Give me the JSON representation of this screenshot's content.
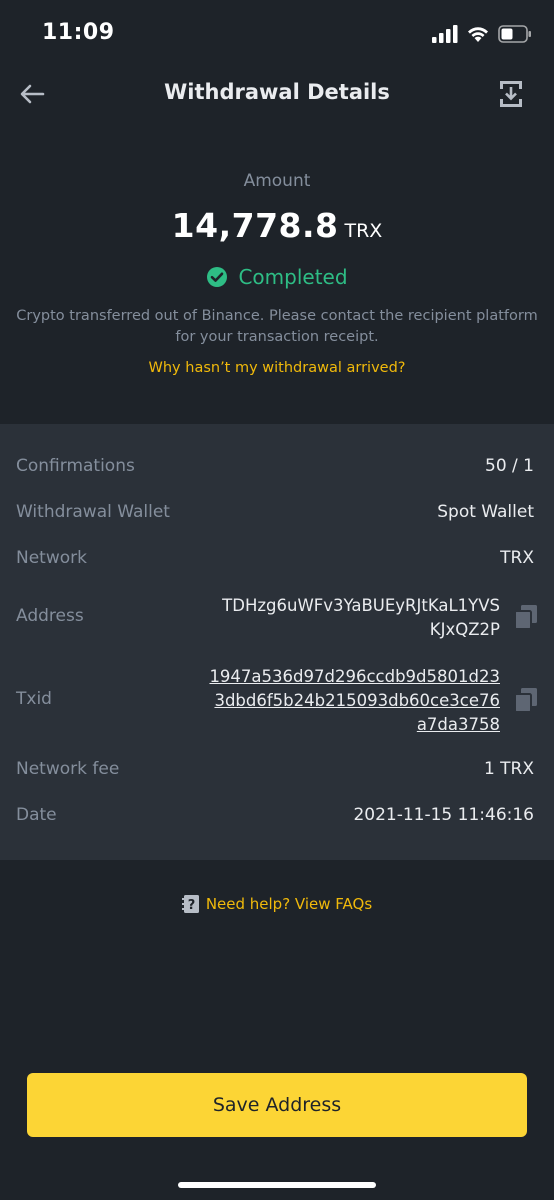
{
  "status_bar": {
    "time": "11:09",
    "icons": [
      "signal-icon",
      "wifi-icon",
      "battery-icon"
    ]
  },
  "nav": {
    "title": "Withdrawal Details",
    "back_icon": "back-arrow-icon",
    "share_icon": "share-export-icon"
  },
  "summary": {
    "amount_label": "Amount",
    "amount_value": "14,778.8",
    "amount_unit": "TRX",
    "status": "Completed",
    "status_color": "#2ebd85",
    "info_line1": "Crypto transferred out of Binance. Please contact the recipient platform",
    "info_line2": "for your transaction receipt.",
    "help_link": "Why hasn’t my withdrawal arrived?"
  },
  "details": {
    "confirmations": {
      "label": "Confirmations",
      "value": "50 / 1"
    },
    "wallet": {
      "label": "Withdrawal Wallet",
      "value": "Spot Wallet"
    },
    "network": {
      "label": "Network",
      "value": "TRX"
    },
    "address": {
      "label": "Address",
      "line1": "TDHzg6uWFv3YaBUEyRJtKaL1YVS",
      "line2": "KJxQZ2P"
    },
    "txid": {
      "label": "Txid",
      "line1": "1947a536d97d296ccdb9d5801d23",
      "line2": "3dbd6f5b24b215093db60ce3ce76",
      "line3": "a7da3758"
    },
    "fee": {
      "label": "Network fee",
      "value": "1 TRX"
    },
    "date": {
      "label": "Date",
      "value": "2021-11-15 11:46:16"
    }
  },
  "faq": {
    "text": "Need help? View FAQs",
    "icon": "faq-help-icon"
  },
  "save_button": {
    "label": "Save Address"
  },
  "colors": {
    "background": "#1e2329",
    "panel": "#2b3139",
    "accent": "#fcd535",
    "link": "#f0b90b",
    "muted": "#848e9c"
  }
}
